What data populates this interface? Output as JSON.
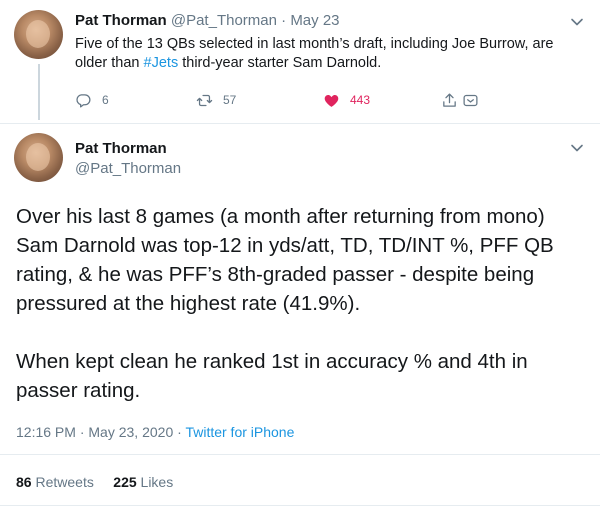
{
  "reply_context": {
    "name": "Pat Thorman",
    "handle": "@Pat_Thorman",
    "separator": " · ",
    "date": "May 23",
    "text_before": "Five of the 13 QBs selected in last month’s draft, including Joe Burrow, are older than ",
    "hashtag": "#Jets",
    "text_after": " third-year starter Sam Darnold.",
    "reply_count": "6",
    "retweet_count": "57",
    "like_count": "443"
  },
  "tweet": {
    "name": "Pat Thorman",
    "handle": "@Pat_Thorman",
    "paragraph1": "Over his last 8 games (a month after returning from mono) Sam Darnold was top-12 in yds/att, TD, TD/INT %, PFF QB rating, & he was PFF’s 8th-graded passer - despite being pressured at the highest rate (41.9%).",
    "paragraph2": "When kept clean he ranked 1st in accuracy % and 4th in passer rating.",
    "time": "12:16 PM",
    "date": "May 23, 2020",
    "dot": " · ",
    "source": "Twitter for iPhone",
    "retweets": "86",
    "retweets_label": "Retweets",
    "likes": "225",
    "likes_label": "Likes"
  },
  "colors": {
    "link": "#1b95e0",
    "muted": "#657786",
    "like": "#e0245e"
  },
  "icons": [
    "reply-icon",
    "retweet-icon",
    "heart-icon",
    "share-icon",
    "chevron-down-icon"
  ]
}
